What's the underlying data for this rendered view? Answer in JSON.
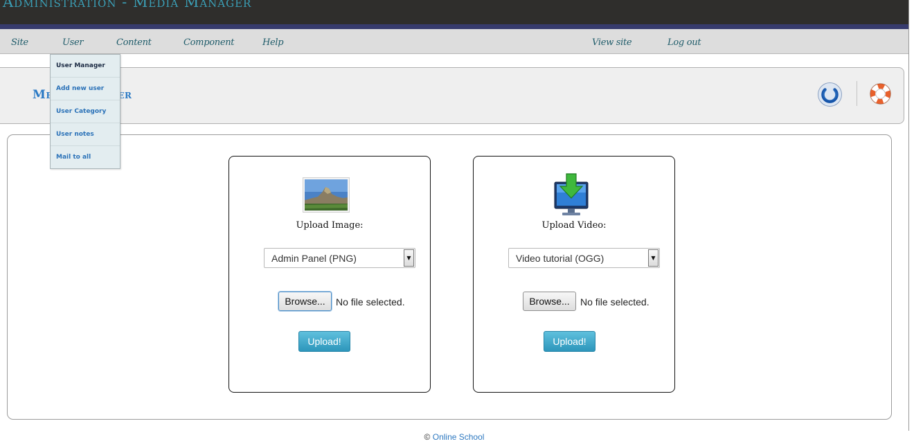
{
  "header": {
    "title": "Administration - Media Manager"
  },
  "nav": {
    "items": [
      {
        "label": "Site"
      },
      {
        "label": "User"
      },
      {
        "label": "Content"
      },
      {
        "label": "Component"
      },
      {
        "label": "Help"
      }
    ],
    "right_items": [
      {
        "label": "View site"
      },
      {
        "label": "Log out"
      }
    ]
  },
  "user_menu": {
    "items": [
      {
        "label": "User Manager"
      },
      {
        "label": "Add new user"
      },
      {
        "label": "User Category"
      },
      {
        "label": "User notes"
      },
      {
        "label": "Mail to all"
      }
    ]
  },
  "page": {
    "title": "Media Manager"
  },
  "toolbar_icons": {
    "power": "power-icon",
    "help": "lifebuoy-icon"
  },
  "image_card": {
    "icon": "landscape-image-icon",
    "label": "Upload Image:",
    "select_value": "Admin Panel (PNG)",
    "browse_label": "Browse...",
    "file_status": "No file selected.",
    "upload_label": "Upload!"
  },
  "video_card": {
    "icon": "monitor-download-icon",
    "label": "Upload Video:",
    "select_value": "Video tutorial (OGG)",
    "browse_label": "Browse...",
    "file_status": "No file selected.",
    "upload_label": "Upload!"
  },
  "footer": {
    "copyright_symbol": "©",
    "link_text": "Online School"
  },
  "colors": {
    "header_bg": "#2f2e2c",
    "header_title": "#3b9fb6",
    "nav_bg": "#dddddd",
    "accent_blue": "#2b7ac5",
    "upload_button": "#2d96bb"
  }
}
